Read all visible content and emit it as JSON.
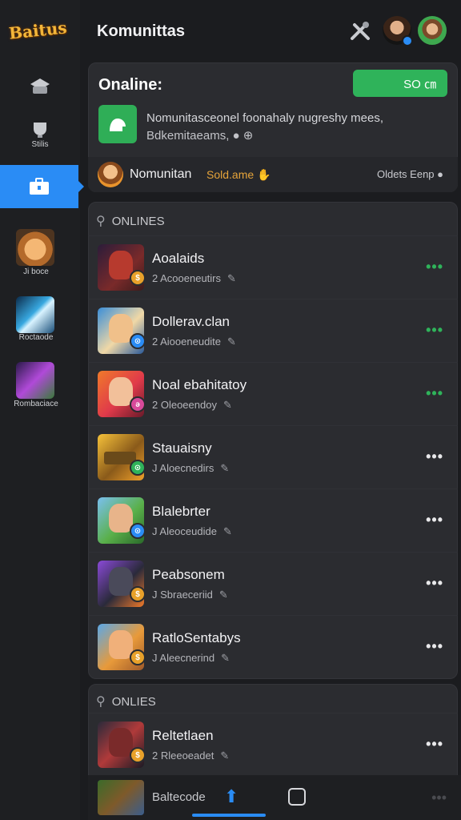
{
  "app": {
    "logo_text": "Baitus",
    "title": "Komunittas"
  },
  "header_icons": [
    "tools-icon",
    "avatar-user-1",
    "avatar-user-2"
  ],
  "rail": {
    "items": [
      {
        "icon": "controller-icon",
        "label": ""
      },
      {
        "icon": "trophy-icon",
        "label": "Stilis"
      },
      {
        "icon": "briefcase-icon",
        "label": ""
      }
    ],
    "games": [
      {
        "label": "Ji boce"
      },
      {
        "label": "Roctaode"
      },
      {
        "label": "Rombaciace"
      }
    ]
  },
  "online_card": {
    "title": "Onaline:",
    "action_label": "SO ㎝",
    "notice_line1": "Nomunitasceonel foonahaly nugreshy mees,",
    "notice_line2": "Bdkemitaeams, ● ⊕"
  },
  "status": {
    "name": "Nomunitan",
    "state": "Sold.ame ✋",
    "right_text": "Oldets Eenp ●"
  },
  "section1": {
    "label": "ONLINES"
  },
  "section2": {
    "label": "ONLIES"
  },
  "list": [
    {
      "name": "Aoalaids",
      "meta": "2 Acooeneutirs",
      "more": "•••"
    },
    {
      "name": "Dollerav.clan",
      "meta": "2 Aiooeneudite",
      "more": "•••"
    },
    {
      "name": "Noal ebahitatoy",
      "meta": "2 Oleoeendoy",
      "more": "•••"
    },
    {
      "name": "Stauaisny",
      "meta": "J Aloecnedirs",
      "more": "•••"
    },
    {
      "name": "Blalebrter",
      "meta": "J Aleoceudide",
      "more": "•••"
    },
    {
      "name": "Peabsonem",
      "meta": "J Sbraeceriid",
      "more": "•••"
    },
    {
      "name": "RatloSentabys",
      "meta": "J Aleecnerind",
      "more": "•••"
    }
  ],
  "list2": [
    {
      "name": "Reltetlaen",
      "meta": "2 Rleeoeadet",
      "more": "•••"
    }
  ],
  "bottom": {
    "label": "Baltecode"
  },
  "colors": {
    "accent": "#2a8cf5",
    "online": "#2fb35a",
    "bg": "#1b1c1f",
    "card": "#2b2c30"
  }
}
